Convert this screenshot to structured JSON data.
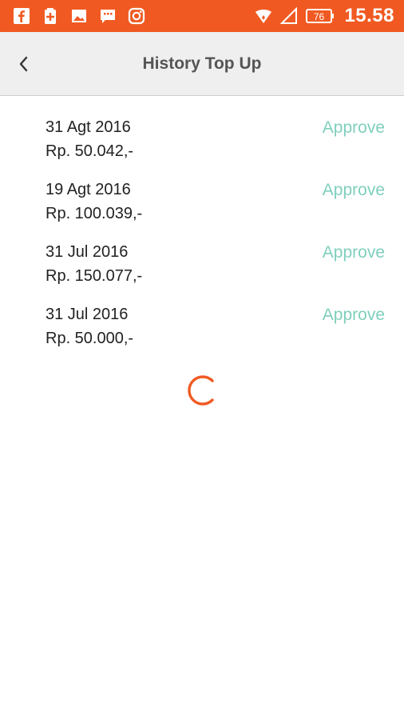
{
  "status_bar": {
    "icons": [
      "facebook-icon",
      "battery-saver-icon",
      "gallery-icon",
      "chat-icon",
      "instagram-icon"
    ],
    "right_icons": [
      "wifi-icon",
      "signal-icon",
      "battery-icon"
    ],
    "battery": "76",
    "time": "15.58",
    "color": "#f05a22"
  },
  "appbar": {
    "title": "History Top Up",
    "back_icon": "chevron-left-icon"
  },
  "history": [
    {
      "date": "31 Agt 2016",
      "amount": "Rp. 50.042,-",
      "status": "Approve"
    },
    {
      "date": "19 Agt 2016",
      "amount": "Rp. 100.039,-",
      "status": "Approve"
    },
    {
      "date": "31 Jul 2016",
      "amount": "Rp. 150.077,-",
      "status": "Approve"
    },
    {
      "date": "31 Jul 2016",
      "amount": "Rp. 50.000,-",
      "status": "Approve"
    }
  ],
  "colors": {
    "accent": "#f05a22",
    "status_text": "#7fcfbd",
    "appbar_bg": "#efefef"
  },
  "loading_icon": "loading-spinner-icon"
}
